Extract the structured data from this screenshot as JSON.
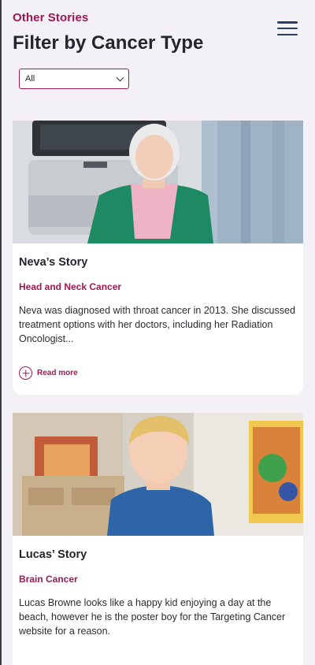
{
  "header": {
    "eyebrow": "Other Stories",
    "title": "Filter by Cancer Type",
    "menu_icon": "hamburger-menu-icon"
  },
  "filter": {
    "selected": "All"
  },
  "stories": [
    {
      "title": "Neva’s Story",
      "category": "Head and Neck Cancer",
      "excerpt": "Neva was diagnosed with throat cancer in 2013. She discussed treatment options with her doctors, including her Radiation Oncologist...",
      "read_more": "Read more"
    },
    {
      "title": "Lucas’ Story",
      "category": "Brain Cancer",
      "excerpt": "Lucas Browne looks like a happy kid enjoying a day at the beach, however he is the poster boy for the Targeting Cancer website for a reason."
    }
  ],
  "colors": {
    "accent": "#9b1a52",
    "menu": "#2c3e63",
    "background": "#f3f1f5"
  }
}
